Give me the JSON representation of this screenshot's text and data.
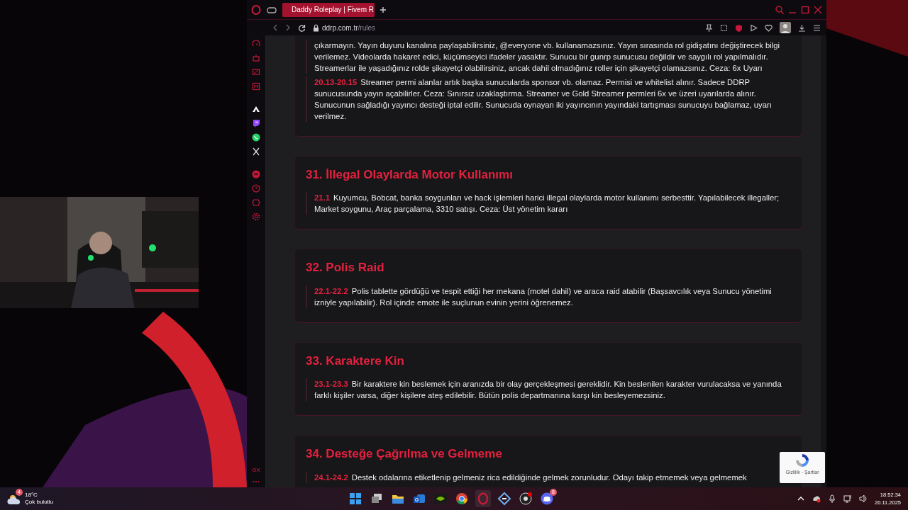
{
  "browser": {
    "tab": {
      "title": "Daddy Roleplay | Fivem R",
      "selected": true
    },
    "address": {
      "domain": "ddrp.com.tr",
      "path": "/rules"
    },
    "sidebar_footer": "GX"
  },
  "sections": [
    {
      "rules": [
        {
          "text": "çıkarmayın. Yayın duyuru kanalına paylaşabilirsiniz, @everyone vb. kullanamazsınız. Yayın sırasında rol gidişatını değiştirecek bilgi verilemez. Videolarda hakaret edici, küçümseyici ifadeler yasaktır. Sunucu bir gunrp sunucusu değildir ve saygılı rol yapılmalıdır. Streamerlar ile yaşadığınız rolde şikayetçi olabilirsiniz, ancak dahil olmadığınız roller için şikayetçi olamazsınız. Ceza: 6x Uyarı"
        },
        {
          "code": "20.13-20.15",
          "text": "Streamer permi alanlar artık başka sunucularda sponsor vb. olamaz. Permisi ve whitelist alınır. Sadece DDRP sunucusunda yayın açabilirler. Ceza: Sınırsız uzaklaştırma. Streamer ve Gold Streamer permleri 6x ve üzeri uyarılarda alınır. Sunucunun sağladığı yayıncı desteği iptal edilir. Sunucuda oynayan iki yayıncının yayındaki tartışması sunucuyu bağlamaz, uyarı verilmez."
        }
      ]
    },
    {
      "heading": "31. İllegal Olaylarda Motor Kullanımı",
      "rules": [
        {
          "code": "21.1",
          "text": "Kuyumcu, Bobcat, banka soygunları ve hack işlemleri harici illegal olaylarda motor kullanımı serbesttir. Yapılabilecek illegaller; Market soygunu, Araç parçalama, 3310 satışı. Ceza: Üst yönetim kararı"
        }
      ]
    },
    {
      "heading": "32. Polis Raid",
      "rules": [
        {
          "code": "22.1-22.2",
          "text": "Polis tablette gördüğü ve tespit ettiği her mekana (motel dahil) ve araca raid atabilir (Başsavcılık veya Sunucu yönetimi izniyle yapılabilir). Rol içinde emote ile suçlunun evinin yerini öğrenemez."
        }
      ]
    },
    {
      "heading": "33. Karaktere Kin",
      "rules": [
        {
          "code": "23.1-23.3",
          "text": "Bir karaktere kin beslemek için aranızda bir olay gerçekleşmesi gereklidir. Kin beslenilen karakter vurulacaksa ve yanında farklı kişiler varsa, diğer kişilere ateş edilebilir. Bütün polis departmanına karşı kin besleyemezsiniz."
        }
      ]
    },
    {
      "heading": "34. Desteğe Çağrılma ve Gelmeme",
      "rules": [
        {
          "code": "24.1-24.2",
          "text": "Destek odalarına etiketlenip gelmeniz rica edildiğinde gelmek zorunludur. Odayı takip etmemek veya gelmemek"
        }
      ]
    }
  ],
  "recaptcha": {
    "links": "Gizlilik - Şartlar"
  },
  "taskbar": {
    "weather": {
      "temperature": "18°C",
      "condition": "Çok bulutlu",
      "badge": "4"
    },
    "apps": [
      {
        "kind": "start"
      },
      {
        "kind": "taskview"
      },
      {
        "kind": "folder"
      },
      {
        "kind": "mail"
      },
      {
        "kind": "nvidia"
      },
      {
        "kind": "chrome"
      },
      {
        "kind": "opera",
        "selected": true
      },
      {
        "kind": "tool"
      },
      {
        "kind": "obs"
      },
      {
        "kind": "discord",
        "badge": "8"
      }
    ],
    "time": "18:52:34",
    "date": "20.11.2025"
  }
}
